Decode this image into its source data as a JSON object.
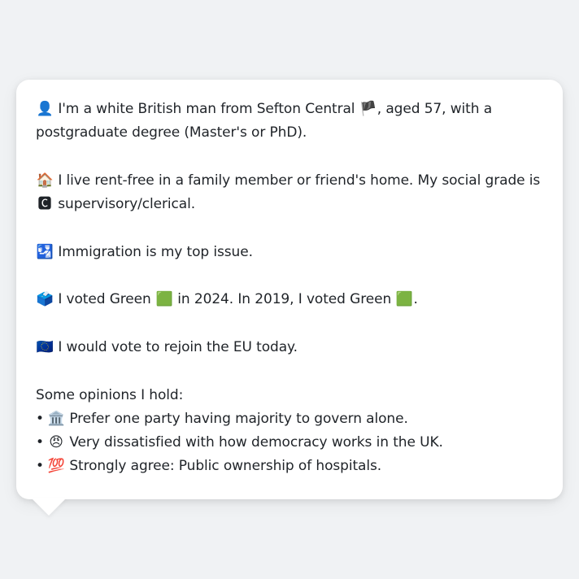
{
  "profile": {
    "p1": {
      "icon": "👤",
      "text_a": "I'm a white British man from Sefton Central ",
      "flag": "🏴",
      "text_b": ", aged 57, with a postgraduate degree (Master's or PhD)."
    },
    "p2": {
      "icon": "🏠",
      "text_a": "I live rent-free in a family member or friend's home. My social grade is ",
      "badge": "🅲",
      "text_b": " supervisory/clerical."
    },
    "p3": {
      "icon": "🛂",
      "text": "Immigration is my top issue."
    },
    "p4": {
      "icon": "🗳️",
      "text_a": "I voted Green ",
      "sq1": "🟩",
      "text_b": " in 2024. In 2019, I voted Green ",
      "sq2": "🟩",
      "text_c": "."
    },
    "p5": {
      "icon": "🇪🇺",
      "text": "I would vote to rejoin the EU today."
    },
    "opinions": {
      "heading": "Some opinions I hold:",
      "items": [
        {
          "bullet": "•",
          "icon": "🏛️",
          "text": "Prefer one party having majority to govern alone."
        },
        {
          "bullet": "•",
          "icon": "😠",
          "text": "Very dissatisfied with how democracy works in the UK."
        },
        {
          "bullet": "•",
          "icon": "💯",
          "text": "Strongly agree: Public ownership of hospitals."
        }
      ]
    }
  }
}
